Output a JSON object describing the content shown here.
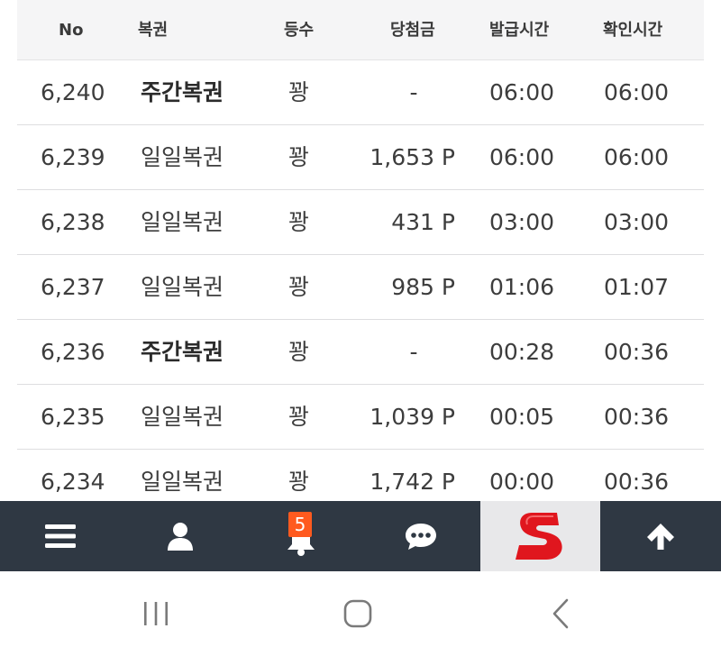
{
  "table": {
    "headers": {
      "no": "No",
      "type": "복권",
      "rank": "등수",
      "prize": "당첨금",
      "issued": "발급시간",
      "checked": "확인시간"
    },
    "rows": [
      {
        "no": "6,240",
        "type": "주간복권",
        "type_bold": true,
        "rank": "꽝",
        "prize": "-",
        "issued": "06:00",
        "checked": "06:00"
      },
      {
        "no": "6,239",
        "type": "일일복권",
        "type_bold": false,
        "rank": "꽝",
        "prize": "1,653 P",
        "issued": "06:00",
        "checked": "06:00"
      },
      {
        "no": "6,238",
        "type": "일일복권",
        "type_bold": false,
        "rank": "꽝",
        "prize": "431 P",
        "issued": "03:00",
        "checked": "03:00"
      },
      {
        "no": "6,237",
        "type": "일일복권",
        "type_bold": false,
        "rank": "꽝",
        "prize": "985 P",
        "issued": "01:06",
        "checked": "01:07"
      },
      {
        "no": "6,236",
        "type": "주간복권",
        "type_bold": true,
        "rank": "꽝",
        "prize": "-",
        "issued": "00:28",
        "checked": "00:36"
      },
      {
        "no": "6,235",
        "type": "일일복권",
        "type_bold": false,
        "rank": "꽝",
        "prize": "1,039 P",
        "issued": "00:05",
        "checked": "00:36"
      },
      {
        "no": "6,234",
        "type": "일일복권",
        "type_bold": false,
        "rank": "꽝",
        "prize": "1,742 P",
        "issued": "00:00",
        "checked": "00:36"
      }
    ]
  },
  "bottom_nav": {
    "items": [
      {
        "icon": "menu-icon"
      },
      {
        "icon": "user-icon"
      },
      {
        "icon": "bell-icon",
        "badge": "5"
      },
      {
        "icon": "chat-icon"
      },
      {
        "icon": "logo-s-icon"
      },
      {
        "icon": "arrow-up-icon"
      }
    ],
    "colors": {
      "bar": "#2f3843",
      "badge": "#ff5a1f",
      "logo": "#e0161e"
    }
  },
  "system_nav": {
    "items": [
      {
        "icon": "recents-icon"
      },
      {
        "icon": "home-icon"
      },
      {
        "icon": "back-icon"
      }
    ]
  }
}
